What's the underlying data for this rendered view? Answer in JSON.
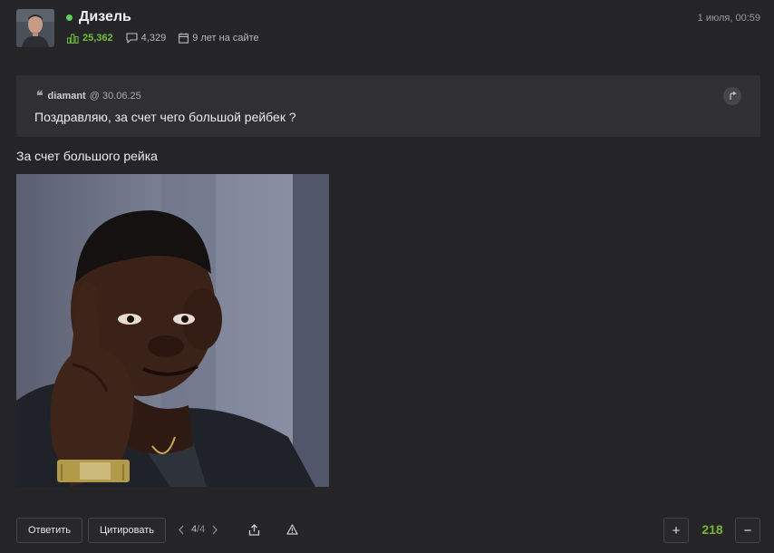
{
  "author": {
    "name": "Дизель",
    "rating": "25,362",
    "posts": "4,329",
    "membership": "9 лет на сайте"
  },
  "post_date": "1 июля, 00:59",
  "quote": {
    "icon": "❝",
    "user": "diamant",
    "date": "@ 30.06.25",
    "text": "Поздравляю, за счет чего большой рейбек ?"
  },
  "body": {
    "text": "За счет большого рейка"
  },
  "footer": {
    "reply_label": "Ответить",
    "quote_label": "Цитировать",
    "page_current": "4",
    "page_total": "/4",
    "vote_up": "+",
    "vote_down": "−",
    "score": "218"
  },
  "colors": {
    "online": "#5fcf5a",
    "rating": "#6fbf3b",
    "score": "#79b431",
    "background": "#252527",
    "quote_background": "#303033"
  },
  "icons": {
    "rating": "bar-chart-icon",
    "posts": "chat-icon",
    "membership": "calendar-icon",
    "quote_jump": "jump-arrow-icon",
    "share": "share-icon",
    "report": "warning-icon",
    "page_prev": "chevron-left-icon",
    "page_next": "chevron-right-icon"
  }
}
